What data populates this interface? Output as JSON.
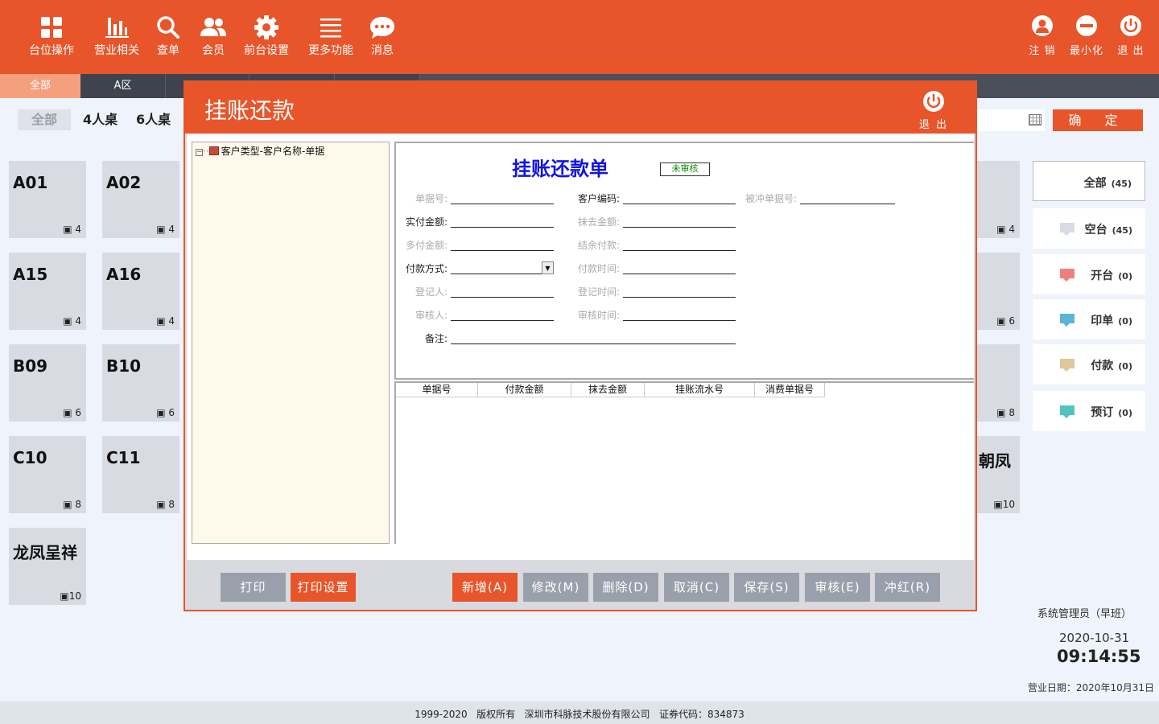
{
  "nav": {
    "items": [
      {
        "label": "台位操作",
        "icon": "grid-icon"
      },
      {
        "label": "营业相关",
        "icon": "bar-chart-icon"
      },
      {
        "label": "查单",
        "icon": "search-icon"
      },
      {
        "label": "会员",
        "icon": "users-icon"
      },
      {
        "label": "前台设置",
        "icon": "gear-icon"
      },
      {
        "label": "更多功能",
        "icon": "menu-icon"
      },
      {
        "label": "消息",
        "icon": "chat-icon"
      }
    ],
    "right": [
      {
        "label": "注 销",
        "icon": "user-logout-icon"
      },
      {
        "label": "最小化",
        "icon": "minimize-icon"
      },
      {
        "label": "退 出",
        "icon": "power-icon"
      }
    ]
  },
  "areas": {
    "all": "全部",
    "a": "A区"
  },
  "capacity": {
    "all": "全部",
    "four": "4人桌",
    "six": "6人桌"
  },
  "tables": [
    {
      "name": "A01",
      "seats": "4"
    },
    {
      "name": "A02",
      "seats": "4"
    },
    {
      "name": "A15",
      "seats": "4"
    },
    {
      "name": "A16",
      "seats": "4"
    },
    {
      "name": "B09",
      "seats": "6"
    },
    {
      "name": "B10",
      "seats": "6"
    },
    {
      "name": "C10",
      "seats": "8"
    },
    {
      "name": "C11",
      "seats": "8"
    },
    {
      "name": "龙凤呈祥",
      "seats": "10"
    }
  ],
  "right_tables": [
    {
      "name": "",
      "seats": "4"
    },
    {
      "name": "",
      "seats": "6"
    },
    {
      "name": "",
      "seats": "8"
    },
    {
      "name": "朝凤",
      "seats": "10"
    }
  ],
  "confirm": "确 定",
  "legend": [
    {
      "label": "全部",
      "count": "(45)",
      "color": ""
    },
    {
      "label": "空台",
      "count": "(45)",
      "color": "#d8dae6"
    },
    {
      "label": "开台",
      "count": "(0)",
      "color": "#f08080"
    },
    {
      "label": "印单",
      "count": "(0)",
      "color": "#5ab4d6"
    },
    {
      "label": "付款",
      "count": "(0)",
      "color": "#dcc89a"
    },
    {
      "label": "预订",
      "count": "(0)",
      "color": "#4fc4c0"
    }
  ],
  "status": {
    "user": "系统管理员（早班）",
    "date": "2020-10-31",
    "time": "09:14:55",
    "business_date": "营业日期：2020年10月31日"
  },
  "footer": "1999-2020   版权所有   深圳市科脉技术股份有限公司   证券代码：834873",
  "modal": {
    "title": "挂账还款",
    "exit": "退 出",
    "tree_root": "客户类型-客户名称-单据",
    "form_title": "挂账还款单",
    "status": "未审核",
    "fields": {
      "doc_no": "单据号:",
      "customer_code": "客户编码:",
      "offset_doc_no": "被冲单据号:",
      "paid_amount": "实付金额:",
      "wipe_amount": "抹去金额:",
      "over_paid": "多付金额:",
      "balance_paid": "结余付款:",
      "pay_method": "付款方式:",
      "pay_time": "付款时间:",
      "registrar": "登记人:",
      "register_time": "登记时间:",
      "auditor": "审核人:",
      "audit_time": "审核时间:",
      "remark": "备注:"
    },
    "grid_columns": [
      "单据号",
      "付款金额",
      "抹去金额",
      "挂账流水号",
      "消费单据号"
    ],
    "buttons": {
      "print": "打印",
      "print_settings": "打印设置",
      "add": "新增(A)",
      "edit": "修改(M)",
      "delete": "删除(D)",
      "cancel": "取消(C)",
      "save": "保存(S)",
      "audit": "审核(E)",
      "reverse": "冲红(R)"
    }
  }
}
